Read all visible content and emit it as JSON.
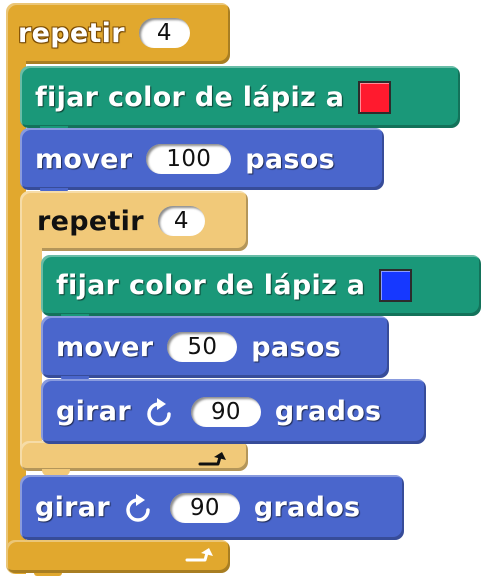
{
  "outer_repeat": {
    "label": "repetir",
    "count": "4",
    "color": "#e1a82e",
    "loop_icon": "loop-arrow-icon"
  },
  "set_red": {
    "label": "fijar color de lápiz a",
    "swatch": "#ff1a2e"
  },
  "move_100": {
    "label_move": "mover",
    "steps": "100",
    "label_steps": "pasos"
  },
  "inner_repeat": {
    "label": "repetir",
    "count": "4",
    "color": "#f1c979",
    "loop_icon": "loop-arrow-icon"
  },
  "set_blue": {
    "label": "fijar color de lápiz a",
    "swatch": "#1638ff"
  },
  "move_50": {
    "label_move": "mover",
    "steps": "50",
    "label_steps": "pasos"
  },
  "turn_inner": {
    "label_turn": "girar",
    "icon": "rotate-clockwise-icon",
    "degrees": "90",
    "label_degrees": "grados"
  },
  "turn_outer": {
    "label_turn": "girar",
    "icon": "rotate-clockwise-icon",
    "degrees": "90",
    "label_degrees": "grados"
  },
  "colors": {
    "motion": "#4a66cc",
    "pen": "#1a9879"
  }
}
